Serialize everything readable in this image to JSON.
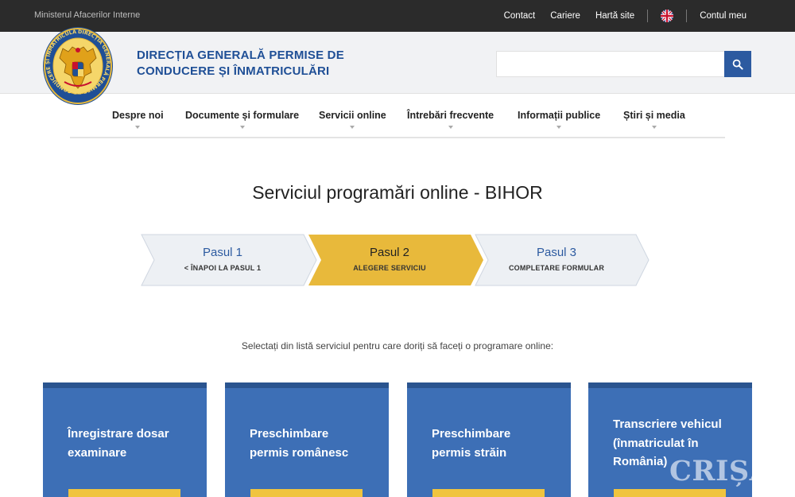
{
  "topbar": {
    "ministry": "Ministerul Afacerilor Interne",
    "links": [
      "Contact",
      "Cariere",
      "Hartă site"
    ],
    "account": "Contul meu"
  },
  "header": {
    "brand_line1": "DIRECȚIA GENERALĂ PERMISE DE",
    "brand_line2": "CONDUCERE ȘI ÎNMATRICULĂRI",
    "logo_ring_text": "DIRECȚIA GENERALĂ PERMISE DE CONDUCERE ȘI ÎNMATRICULĂRI",
    "search_placeholder": ""
  },
  "nav": {
    "items": [
      "Despre noi",
      "Documente și formulare",
      "Servicii online",
      "Întrebări frecvente",
      "Informații publice",
      "Știri și media"
    ]
  },
  "page": {
    "title": "Serviciul programări online - BIHOR",
    "instruction": "Selectați din listă serviciul pentru care doriți să faceți o programare online:"
  },
  "steps": [
    {
      "title": "Pasul 1",
      "subtitle": "< ÎNAPOI LA PASUL 1",
      "state": "done"
    },
    {
      "title": "Pasul 2",
      "subtitle": "ALEGERE SERVICIU",
      "state": "active"
    },
    {
      "title": "Pasul 3",
      "subtitle": "COMPLETARE FORMULAR",
      "state": "pending"
    }
  ],
  "cards": [
    {
      "line1": "Înregistrare dosar",
      "line2": "examinare",
      "line3": ""
    },
    {
      "line1": "Preschimbare",
      "line2": "permis românesc",
      "line3": ""
    },
    {
      "line1": "Preschimbare",
      "line2": "permis străin",
      "line3": ""
    },
    {
      "line1": "Transcriere vehicul",
      "line2": "(înmatriculat în",
      "line3": "România)"
    }
  ],
  "watermark": "CRIȘANA",
  "colors": {
    "topbar": "#2b2b2b",
    "brand_blue": "#1f4f96",
    "card_blue": "#3d6fb6",
    "card_border": "#2a548f",
    "active_step": "#e8b93b",
    "inactive_step": "#edf0f4",
    "accent_yellow": "#f0c43f"
  }
}
